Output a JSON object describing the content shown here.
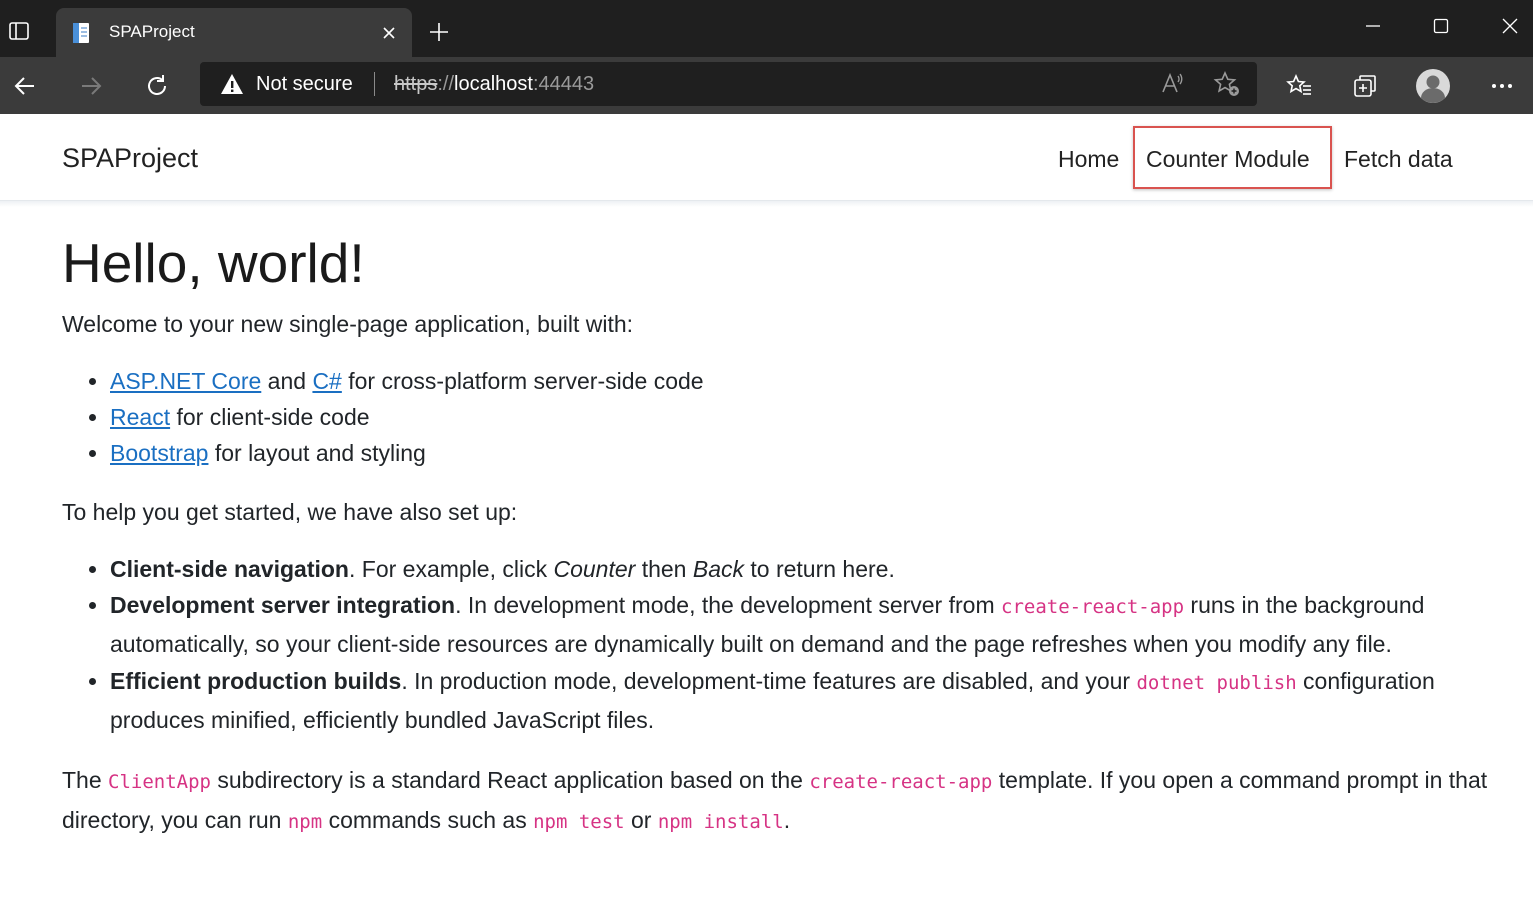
{
  "browser": {
    "tab_title": "SPAProject",
    "security_label": "Not secure",
    "url": {
      "scheme": "https",
      "separator": "://",
      "host": "localhost",
      "port": ":44443"
    }
  },
  "navbar": {
    "brand": "SPAProject",
    "links": [
      "Home",
      "Counter Module",
      "Fetch data"
    ],
    "highlighted_link": "Counter Module",
    "highlight_color": "#d9534f"
  },
  "content": {
    "heading": "Hello, world!",
    "intro": "Welcome to your new single-page application, built with:",
    "tech_list": {
      "item1": {
        "link1": "ASP.NET Core",
        "and": " and ",
        "link2": "C#",
        "rest": " for cross-platform server-side code"
      },
      "item2": {
        "link": "React",
        "rest": " for client-side code"
      },
      "item3": {
        "link": "Bootstrap",
        "rest": " for layout and styling"
      }
    },
    "setup_intro": "To help you get started, we have also set up:",
    "features": {
      "f1": {
        "bold": "Client-side navigation",
        "t1": ". For example, click ",
        "em1": "Counter",
        "t2": " then ",
        "em2": "Back",
        "t3": " to return here."
      },
      "f2": {
        "bold": "Development server integration",
        "t1": ". In development mode, the development server from ",
        "code": "create-react-app",
        "t2": " runs in the background automatically, so your client-side resources are dynamically built on demand and the page refreshes when you modify any file."
      },
      "f3": {
        "bold": "Efficient production builds",
        "t1": ". In production mode, development-time features are disabled, and your ",
        "code": "dotnet publish",
        "t2": " configuration produces minified, efficiently bundled JavaScript files."
      }
    },
    "outro": {
      "t1": "The ",
      "code1": "ClientApp",
      "t2": " subdirectory is a standard React application based on the ",
      "code2": "create-react-app",
      "t3": " template. If you open a command prompt in that directory, you can run ",
      "code3": "npm",
      "t4": " commands such as ",
      "code4": "npm test",
      "t5": " or ",
      "code5": "npm install",
      "t6": "."
    }
  },
  "colors": {
    "chrome_dark": "#1f1f1f",
    "chrome_toolbar": "#3b3b3b",
    "link": "#1a6fc2",
    "code": "#d63384"
  }
}
